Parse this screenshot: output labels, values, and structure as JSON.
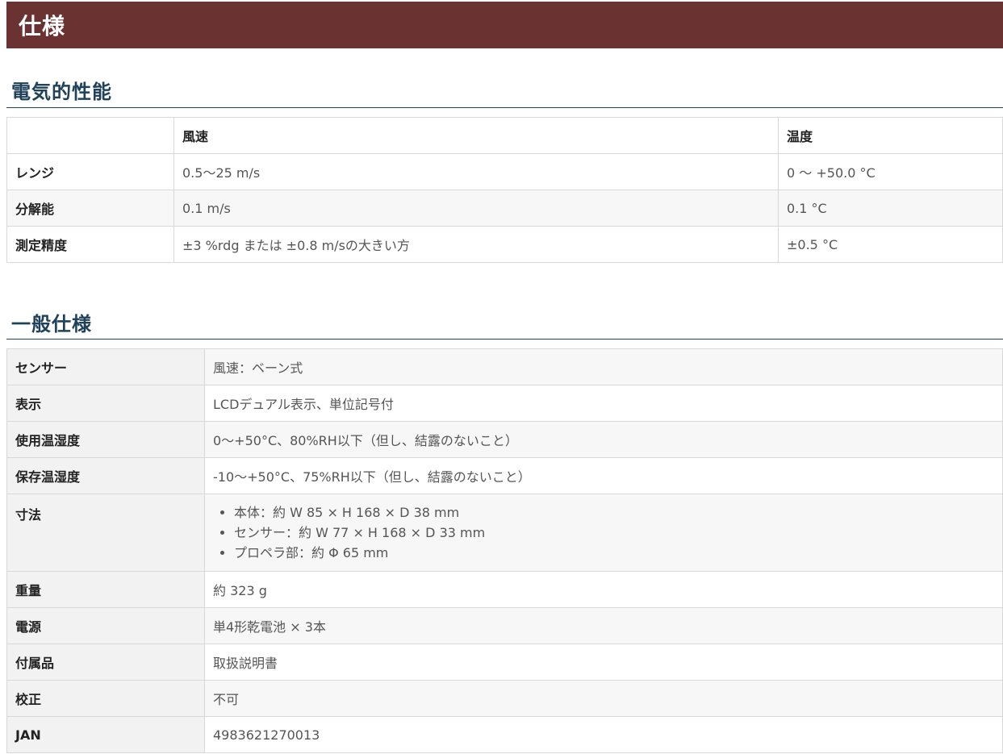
{
  "banner": {
    "title": "仕様"
  },
  "electrical": {
    "heading": "電気的性能",
    "columns": [
      "",
      "風速",
      "温度"
    ],
    "rows": [
      {
        "label": "レンジ",
        "wind": "0.5〜25 m/s",
        "temp": "0 〜 +50.0 °C"
      },
      {
        "label": "分解能",
        "wind": "0.1 m/s",
        "temp": "0.1 °C"
      },
      {
        "label": "測定精度",
        "wind": "±3 %rdg または ±0.8 m/sの大きい方",
        "temp": "±0.5 °C"
      }
    ]
  },
  "general": {
    "heading": "一般仕様",
    "rows": [
      {
        "label": "センサー",
        "value": "風速：ベーン式"
      },
      {
        "label": "表示",
        "value": "LCDデュアル表示、単位記号付"
      },
      {
        "label": "使用温湿度",
        "value": "0〜+50°C、80%RH以下（但し、結露のないこと）"
      },
      {
        "label": "保存温湿度",
        "value": "-10〜+50°C、75%RH以下（但し、結露のないこと）"
      },
      {
        "label": "寸法",
        "items": [
          "本体：約 W 85 × H 168 × D 38 mm",
          "センサー：約 W 77 × H 168 × D 33 mm",
          "プロペラ部：約 Φ 65 mm"
        ]
      },
      {
        "label": "重量",
        "value": "約 323 g"
      },
      {
        "label": "電源",
        "value": "単4形乾電池 × 3本"
      },
      {
        "label": "付属品",
        "value": "取扱説明書"
      },
      {
        "label": "校正",
        "value": "不可"
      },
      {
        "label": "JAN",
        "value": "4983621270013"
      }
    ]
  }
}
